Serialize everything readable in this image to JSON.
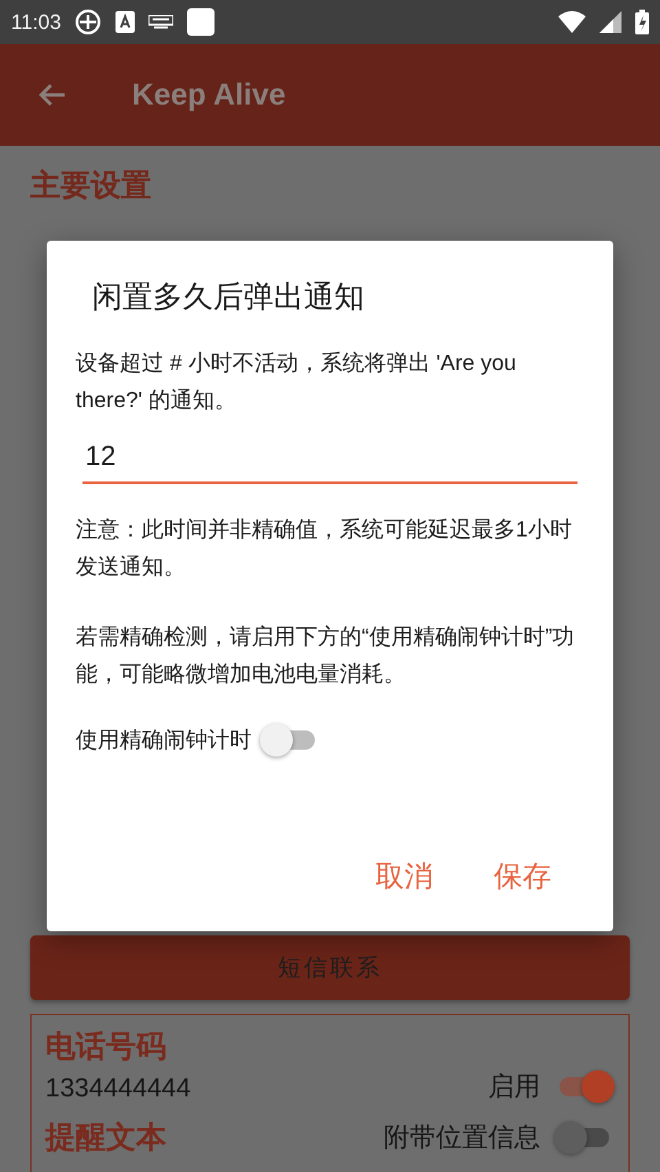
{
  "status_bar": {
    "time": "11:03"
  },
  "app_bar": {
    "title": "Keep Alive"
  },
  "section_title": "主要设置",
  "sms_button": "短信联系",
  "contact_card": {
    "phone_label": "电话号码",
    "phone": "1334444444",
    "enable_label": "启用",
    "enabled": true,
    "message_label": "提醒文本",
    "location_label": "附带位置信息",
    "include_location": false
  },
  "dialog": {
    "title": "闲置多久后弹出通知",
    "description": "设备超过 # 小时不活动，系统将弹出 'Are you there?' 的通知。",
    "value": "12",
    "note": "注意：此时间并非精确值，系统可能延迟最多1小时发送通知。",
    "hint": "若需精确检测，请启用下方的“使用精确闹钟计时”功能，可能略微增加电池电量消耗。",
    "exact_alarm_label": "使用精确闹钟计时",
    "exact_alarm": false,
    "buttons": [
      {
        "label": "取消"
      },
      {
        "label": "保存"
      }
    ]
  }
}
